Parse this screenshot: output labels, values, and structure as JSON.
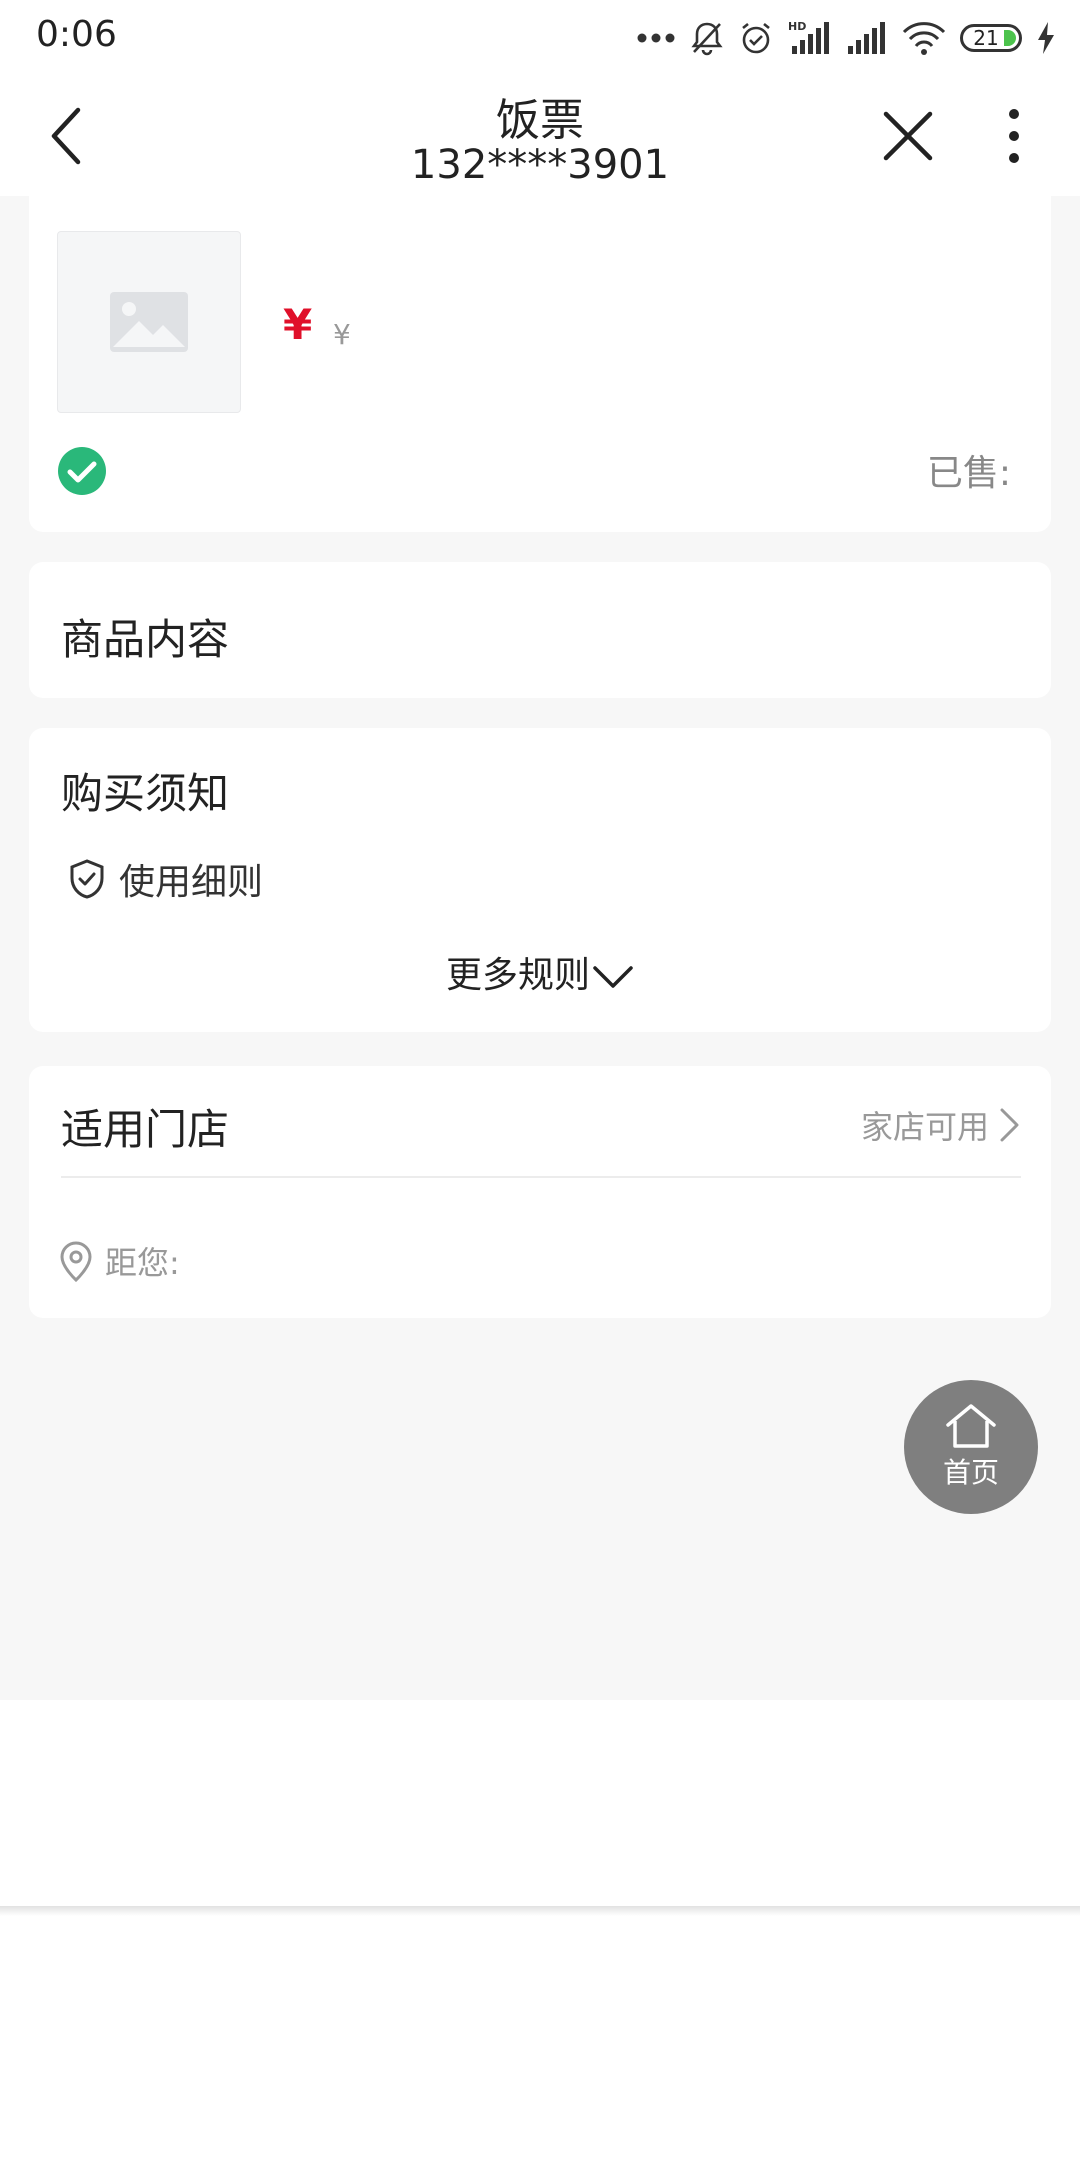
{
  "status_bar": {
    "time": "0:06",
    "battery": "21"
  },
  "nav": {
    "title": "饭票",
    "subtitle": "132****3901"
  },
  "product": {
    "price_symbol": "¥",
    "original_price_symbol": "¥",
    "sold_label": "已售:"
  },
  "content_section": {
    "title": "商品内容"
  },
  "purchase_notice": {
    "title": "购买须知",
    "rule_label": "使用细则",
    "more_rules": "更多规则"
  },
  "stores": {
    "title": "适用门店",
    "availability": "家店可用",
    "distance_label": "距您:"
  },
  "home_button": {
    "label": "首页"
  },
  "colors": {
    "price_red": "#e0102a",
    "badge_green": "#2ab87a",
    "page_bg": "#f7f7f7",
    "fab_gray": "#7f7f7f"
  }
}
